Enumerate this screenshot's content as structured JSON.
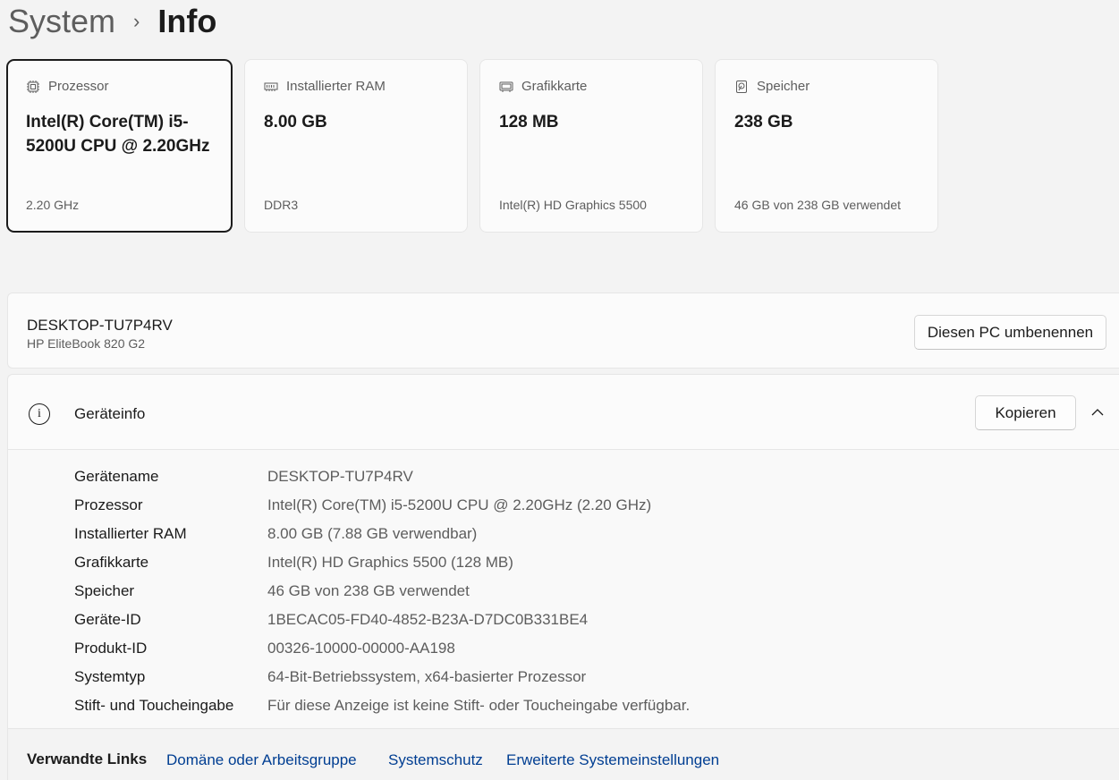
{
  "breadcrumb": {
    "parent": "System",
    "separator": "›",
    "current": "Info"
  },
  "cards": [
    {
      "icon": "cpu-icon",
      "label": "Prozessor",
      "value": "Intel(R) Core(TM) i5-5200U CPU @ 2.20GHz",
      "sub": "2.20 GHz",
      "selected": true
    },
    {
      "icon": "ram-icon",
      "label": "Installierter RAM",
      "value": "8.00 GB",
      "sub": "DDR3"
    },
    {
      "icon": "gpu-icon",
      "label": "Grafikkarte",
      "value": "128 MB",
      "sub": "Intel(R) HD Graphics 5500"
    },
    {
      "icon": "storage-icon",
      "label": "Speicher",
      "value": "238 GB",
      "sub": "46 GB von 238 GB verwendet"
    }
  ],
  "device": {
    "name": "DESKTOP-TU7P4RV",
    "model": "HP EliteBook 820 G2",
    "rename_label": "Diesen PC umbenennen"
  },
  "info": {
    "title": "Geräteinfo",
    "copy_label": "Kopieren",
    "specs": [
      {
        "label": "Gerätename",
        "value": "DESKTOP-TU7P4RV"
      },
      {
        "label": "Prozessor",
        "value": "Intel(R) Core(TM) i5-5200U CPU @ 2.20GHz (2.20 GHz)"
      },
      {
        "label": "Installierter RAM",
        "value": "8.00 GB (7.88 GB verwendbar)"
      },
      {
        "label": "Grafikkarte",
        "value": "Intel(R) HD Graphics 5500 (128 MB)"
      },
      {
        "label": "Speicher",
        "value": "46 GB von 238 GB verwendet"
      },
      {
        "label": "Geräte-ID",
        "value": "1BECAC05-FD40-4852-B23A-D7DC0B331BE4"
      },
      {
        "label": "Produkt-ID",
        "value": "00326-10000-00000-AA198"
      },
      {
        "label": "Systemtyp",
        "value": "64-Bit-Betriebssystem, x64-basierter Prozessor"
      },
      {
        "label": "Stift- und Toucheingabe",
        "value": "Für diese Anzeige ist keine Stift- oder Toucheingabe verfügbar."
      }
    ]
  },
  "related_links": {
    "title": "Verwandte Links",
    "links": [
      "Domäne oder Arbeitsgruppe",
      "Systemschutz",
      "Erweiterte Systemeinstellungen"
    ]
  },
  "colors": {
    "link": "#003e92",
    "secondary_text": "#5d5d5d",
    "background": "#f3f3f3"
  }
}
